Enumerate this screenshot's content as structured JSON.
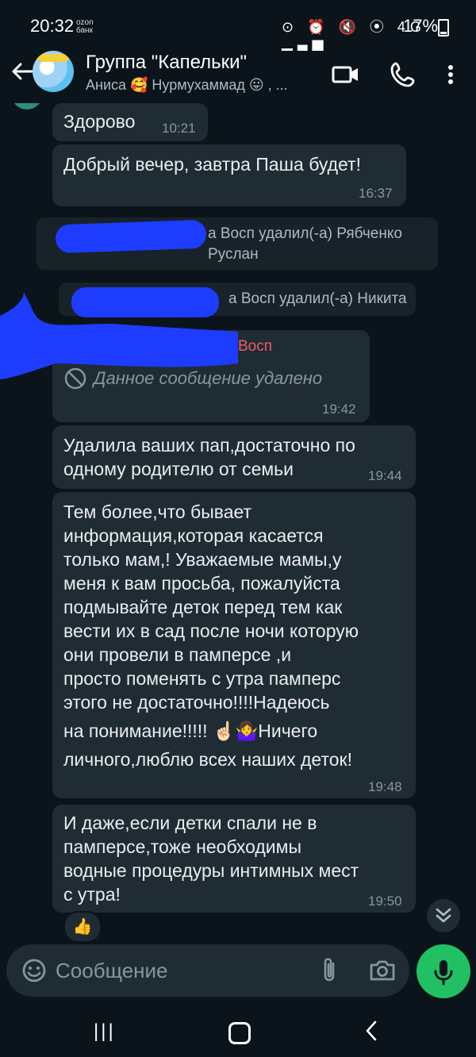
{
  "status": {
    "time": "20:32",
    "ozon_line1": "ozon",
    "ozon_line2": "банк",
    "icons": "⊙ ⏰ 🔇 ⦿ 4G ▂▄▆",
    "battery": "17%"
  },
  "header": {
    "title": "Группа \"Капельки\"",
    "subtitle": "Аниса 🥰 Нурмухаммад 😛 , ...",
    "back_icon": "arrow-left",
    "video_icon": "video-camera",
    "call_icon": "phone",
    "menu_icon": "more-vertical"
  },
  "messages": [
    {
      "text": "Здорово",
      "time": "10:21"
    },
    {
      "text": "Добрый вечер, завтра Паша будет!",
      "time": "16:37"
    },
    {
      "system": "а Восп удалил(-а) Рябченко Руслан"
    },
    {
      "system": "а Восп удалил(-а) Никита"
    },
    {
      "sender": "Восп",
      "deleted": "Данное сообщение удалено",
      "time": "19:42"
    },
    {
      "text": "Удалила ваших пап,достаточно по одному родителю от семьи",
      "time": "19:44"
    },
    {
      "text_lines": [
        "Тем более,что бывает",
        "информация,которая касается",
        "только мам,! Уважаемые мамы,у",
        "меня к вам просьба, пожалуйста",
        "подмывайте деток перед тем как",
        "вести их в сад после ночи которую",
        "они провели в памперсе ,и",
        "просто поменять с утра памперс",
        "этого не достаточно!!!!Надеюсь",
        "на понимание!!!!! ☝🏻🤷‍♀️Ничего",
        "личного,люблю всех наших деток!"
      ],
      "time": "19:48"
    },
    {
      "text_lines": [
        "И даже,если детки спали не в",
        "памперсе,тоже необходимы",
        "водные процедуры интимных мест",
        "с утра!"
      ],
      "time": "19:50"
    }
  ],
  "reaction": "👍",
  "input": {
    "placeholder": "Сообщение"
  },
  "colors": {
    "background": "#0b141a",
    "bubble": "#202c33",
    "accent_green": "#21c063",
    "sender_red": "#ef5a64",
    "scribble_blue": "#1e3cff"
  }
}
